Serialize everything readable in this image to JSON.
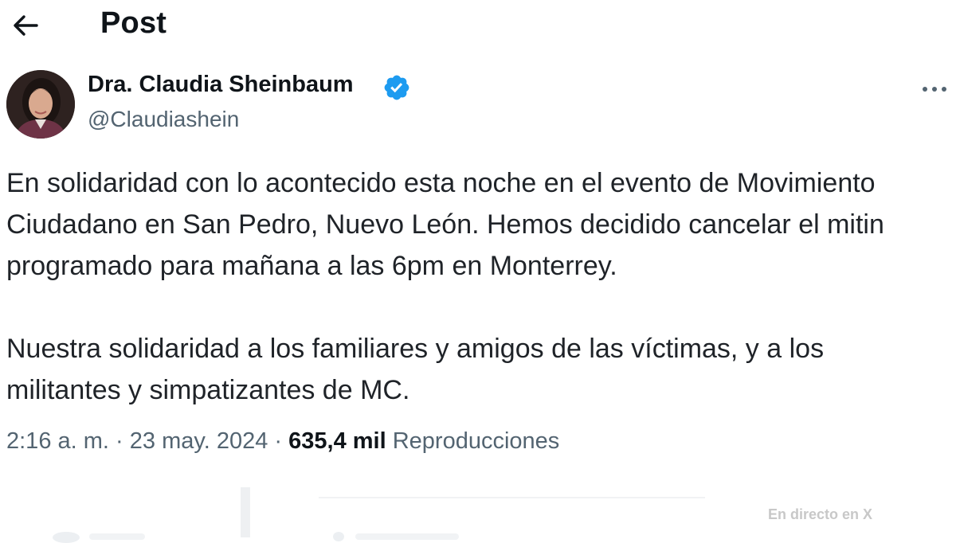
{
  "header": {
    "title": "Post",
    "back_icon": "arrow-left-icon"
  },
  "author": {
    "name": "Dra. Claudia Sheinbaum",
    "handle": "@Claudiashein",
    "verified_icon": "verified-badge-icon",
    "verified_color": "#1d9bf0"
  },
  "post": {
    "paragraph1_lines": [
      "En solidaridad con lo acontecido esta noche en el evento de Movimiento",
      "Ciudadano en San Pedro, Nuevo León. Hemos decidido cancelar el mitin",
      "programado para mañana a las 6pm en Monterrey."
    ],
    "paragraph2_lines": [
      "Nuestra solidaridad a los familiares y amigos de las víctimas, y a los",
      "militantes y simpatizantes de MC."
    ]
  },
  "meta": {
    "time": "2:16 a. m.",
    "separator": "·",
    "date": "23 may. 2024",
    "views_count": "635,4 mil",
    "views_label": "Reproducciones"
  },
  "overlay": {
    "live_label": "En directo en X"
  },
  "colors": {
    "text_primary": "#0f1419",
    "text_secondary": "#536471",
    "accent": "#1d9bf0"
  }
}
